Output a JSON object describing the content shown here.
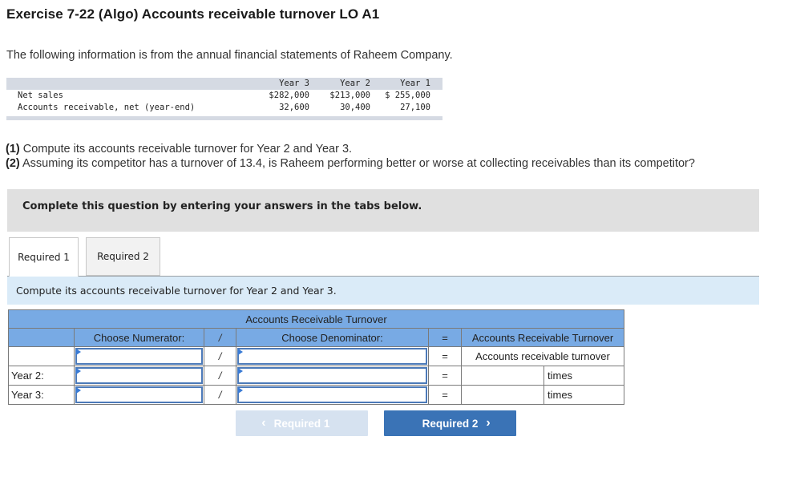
{
  "title": "Exercise 7-22 (Algo) Accounts receivable turnover LO A1",
  "intro": "The following information is from the annual financial statements of Raheem Company.",
  "financials": {
    "headers": [
      "Year 3",
      "Year 2",
      "Year 1"
    ],
    "rows": [
      {
        "label": "Net sales",
        "values": [
          "$282,000",
          "$213,000",
          "$ 255,000"
        ]
      },
      {
        "label": "Accounts receivable, net (year-end)",
        "values": [
          "32,600",
          "30,400",
          "27,100"
        ]
      }
    ]
  },
  "questions": [
    {
      "num": "(1)",
      "text": " Compute its accounts receivable turnover for Year 2 and Year 3."
    },
    {
      "num": "(2)",
      "text": " Assuming its competitor has a turnover of 13.4, is Raheem performing better or worse at collecting receivables than its competitor?"
    }
  ],
  "instruction": "Complete this question by entering your answers in the tabs below.",
  "tabs": [
    {
      "label": "Required 1",
      "active": true
    },
    {
      "label": "Required 2",
      "active": false
    }
  ],
  "tab_prompt": "Compute its accounts receivable turnover for Year 2 and Year 3.",
  "grid": {
    "caption": "Accounts Receivable Turnover",
    "col_numerator": "Choose Numerator:",
    "col_div": "/",
    "col_denominator": "Choose Denominator:",
    "col_eq": "=",
    "col_result": "Accounts Receivable Turnover",
    "rows": [
      {
        "label": "",
        "numerator": "",
        "denominator": "",
        "result": "Accounts receivable turnover",
        "unit": ""
      },
      {
        "label": "Year 2:",
        "numerator": "",
        "denominator": "",
        "result": "",
        "unit": "times"
      },
      {
        "label": "Year 3:",
        "numerator": "",
        "denominator": "",
        "result": "",
        "unit": "times"
      }
    ]
  },
  "nav": {
    "prev_label": "Required 1",
    "next_label": "Required 2",
    "prev_icon": "chevron-left-icon",
    "next_icon": "chevron-right-icon"
  }
}
